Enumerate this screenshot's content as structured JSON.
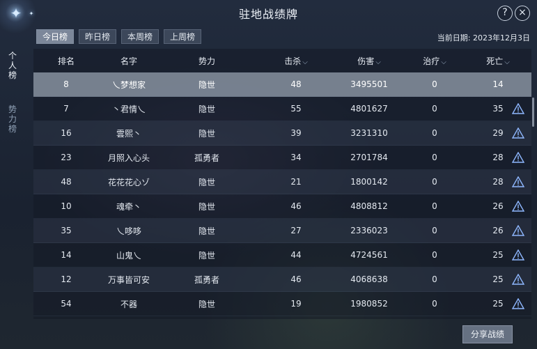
{
  "window": {
    "title": "驻地战绩牌"
  },
  "header": {
    "help_glyph": "?",
    "close_glyph": "×"
  },
  "tabs": [
    "今日榜",
    "昨日榜",
    "本周榜",
    "上周榜"
  ],
  "active_tab": "今日榜",
  "date": {
    "label": "当前日期: 2023年12月3日"
  },
  "side_tabs": [
    {
      "label": "个人榜",
      "active": true
    },
    {
      "label": "势力榜",
      "active": false
    }
  ],
  "table": {
    "columns": [
      "排名",
      "名字",
      "势力",
      "击杀",
      "伤害",
      "治疗",
      "死亡"
    ],
    "sortable_glyph": "⌵",
    "rows": [
      {
        "rank": "8",
        "name": "乀梦想家",
        "faction": "隐世",
        "kills": "48",
        "damage": "3495501",
        "heal": "0",
        "deaths": "14",
        "self": true
      },
      {
        "rank": "7",
        "name": "丶君情乀",
        "faction": "隐世",
        "kills": "55",
        "damage": "4801627",
        "heal": "0",
        "deaths": "35"
      },
      {
        "rank": "16",
        "name": "雲熙丶",
        "faction": "隐世",
        "kills": "39",
        "damage": "3231310",
        "heal": "0",
        "deaths": "29"
      },
      {
        "rank": "23",
        "name": "月照入心头",
        "faction": "孤勇者",
        "kills": "34",
        "damage": "2701784",
        "heal": "0",
        "deaths": "28"
      },
      {
        "rank": "48",
        "name": "花花花心ゾ",
        "faction": "隐世",
        "kills": "21",
        "damage": "1800142",
        "heal": "0",
        "deaths": "28"
      },
      {
        "rank": "10",
        "name": "魂牵丶",
        "faction": "隐世",
        "kills": "46",
        "damage": "4808812",
        "heal": "0",
        "deaths": "26"
      },
      {
        "rank": "35",
        "name": "乀哆哆",
        "faction": "隐世",
        "kills": "27",
        "damage": "2336023",
        "heal": "0",
        "deaths": "26"
      },
      {
        "rank": "14",
        "name": "山鬼乀",
        "faction": "隐世",
        "kills": "44",
        "damage": "4724561",
        "heal": "0",
        "deaths": "25"
      },
      {
        "rank": "12",
        "name": "万事皆可安",
        "faction": "孤勇者",
        "kills": "46",
        "damage": "4068638",
        "heal": "0",
        "deaths": "25"
      },
      {
        "rank": "54",
        "name": "不器",
        "faction": "隐世",
        "kills": "19",
        "damage": "1980852",
        "heal": "0",
        "deaths": "25"
      }
    ]
  },
  "share_button": {
    "label": "分享战绩"
  },
  "colors": {
    "warn": "#8fb8ff",
    "highlight_row": "#969faf"
  },
  "icons": {
    "report": "warning-icon",
    "sparkle": "sparkle-icon"
  }
}
